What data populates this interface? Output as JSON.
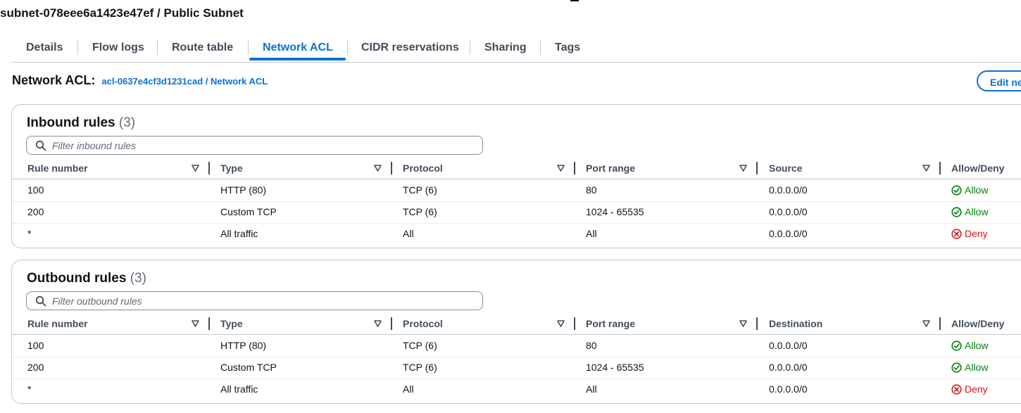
{
  "page": {
    "title": "subnet-078eee6a1423e47ef / Public Subnet"
  },
  "tabs": [
    {
      "label": "Details"
    },
    {
      "label": "Flow logs"
    },
    {
      "label": "Route table"
    },
    {
      "label": "Network ACL"
    },
    {
      "label": "CIDR reservations"
    },
    {
      "label": "Sharing"
    },
    {
      "label": "Tags"
    }
  ],
  "active_tab": "Network ACL",
  "acl": {
    "label": "Network ACL:",
    "link": "acl-0637e4cf3d1231cad / Network ACL",
    "edit_button": "Edit ne"
  },
  "inbound": {
    "title": "Inbound rules",
    "count": "(3)",
    "filter_placeholder": "Filter inbound rules",
    "columns": [
      "Rule number",
      "Type",
      "Protocol",
      "Port range",
      "Source",
      "Allow/Deny"
    ],
    "rows": [
      {
        "rule": "100",
        "type": "HTTP (80)",
        "protocol": "TCP (6)",
        "port": "80",
        "peer": "0.0.0.0/0",
        "action": "Allow"
      },
      {
        "rule": "200",
        "type": "Custom TCP",
        "protocol": "TCP (6)",
        "port": "1024 - 65535",
        "peer": "0.0.0.0/0",
        "action": "Allow"
      },
      {
        "rule": "*",
        "type": "All traffic",
        "protocol": "All",
        "port": "All",
        "peer": "0.0.0.0/0",
        "action": "Deny"
      }
    ]
  },
  "outbound": {
    "title": "Outbound rules",
    "count": "(3)",
    "filter_placeholder": "Filter outbound rules",
    "columns": [
      "Rule number",
      "Type",
      "Protocol",
      "Port range",
      "Destination",
      "Allow/Deny"
    ],
    "rows": [
      {
        "rule": "100",
        "type": "HTTP (80)",
        "protocol": "TCP (6)",
        "port": "80",
        "peer": "0.0.0.0/0",
        "action": "Allow"
      },
      {
        "rule": "200",
        "type": "Custom TCP",
        "protocol": "TCP (6)",
        "port": "1024 - 65535",
        "peer": "0.0.0.0/0",
        "action": "Allow"
      },
      {
        "rule": "*",
        "type": "All traffic",
        "protocol": "All",
        "port": "All",
        "peer": "0.0.0.0/0",
        "action": "Deny"
      }
    ]
  },
  "colors": {
    "accent": "#0972d3",
    "allow": "#037f0c",
    "deny": "#d91515",
    "border": "#c6c6cd"
  }
}
